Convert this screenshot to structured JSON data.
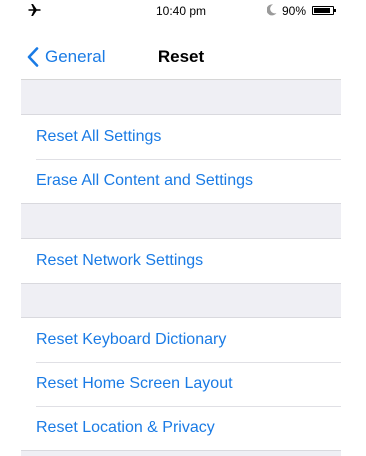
{
  "status_bar": {
    "airplane_icon": "airplane-icon",
    "time": "10:40 pm",
    "moon_icon": "moon-icon",
    "battery_percent": "90%",
    "battery_level": 0.9
  },
  "nav": {
    "back_label": "General",
    "title": "Reset"
  },
  "groups": [
    {
      "items": [
        {
          "label": "Reset All Settings"
        },
        {
          "label": "Erase All Content and Settings"
        }
      ]
    },
    {
      "items": [
        {
          "label": "Reset Network Settings"
        }
      ]
    },
    {
      "items": [
        {
          "label": "Reset Keyboard Dictionary"
        },
        {
          "label": "Reset Home Screen Layout"
        },
        {
          "label": "Reset Location & Privacy"
        }
      ]
    }
  ],
  "colors": {
    "accent": "#1a7be5",
    "background_gap": "#efeff4"
  }
}
